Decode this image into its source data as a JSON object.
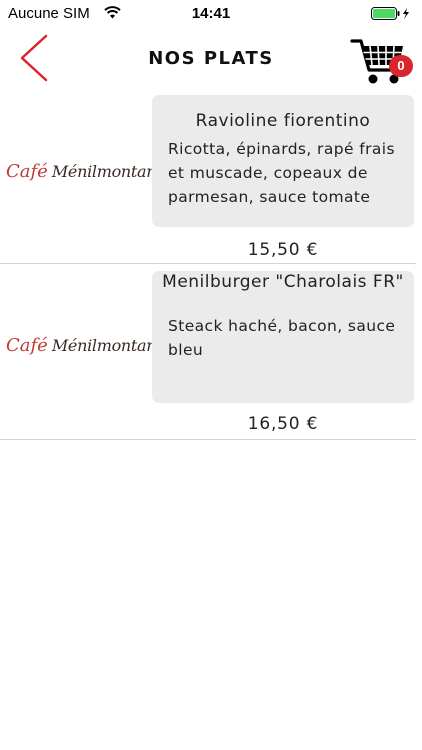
{
  "status_bar": {
    "carrier": "Aucune SIM",
    "time": "14:41"
  },
  "header": {
    "title": "NOS PLATS",
    "cart_count": "0"
  },
  "colors": {
    "accent": "#d9262c",
    "card_background": "#ebebeb",
    "battery": "#4cd964"
  },
  "icons": [
    "wifi-icon",
    "battery-icon",
    "back-chevron-icon",
    "shopping-cart-icon"
  ],
  "brand": {
    "part1": "Café",
    "part2": "Ménilmontant"
  },
  "menu": {
    "items": [
      {
        "name": "Ravioline fiorentino",
        "description": "Ricotta, épinards, rapé frais et muscade, copeaux de parmesan, sauce tomate",
        "price": "15,50 €"
      },
      {
        "name": "Menilburger \"Charolais FR\"",
        "description": "Steack haché, bacon, sauce bleu",
        "price": "16,50 €"
      }
    ]
  }
}
